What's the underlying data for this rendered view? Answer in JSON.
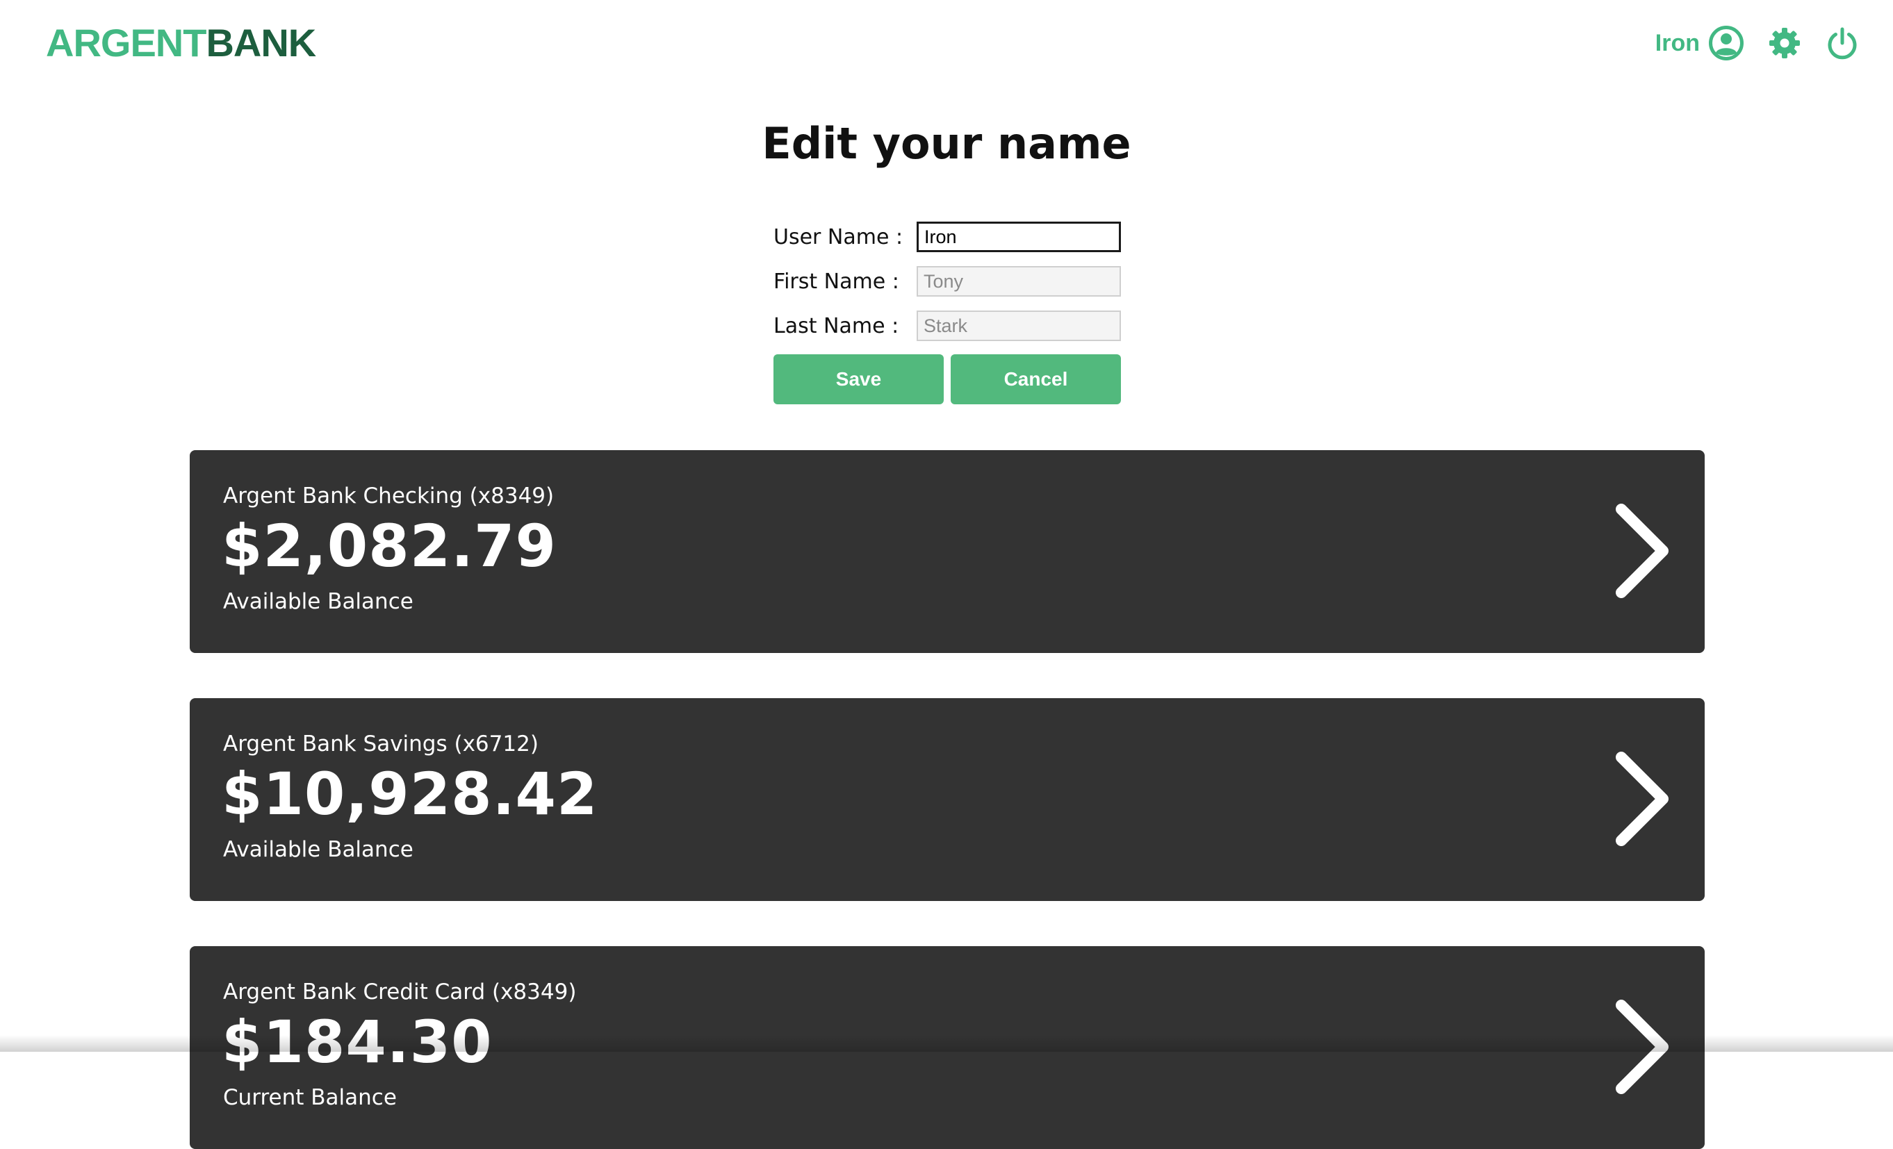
{
  "header": {
    "logo_part1": "ARGENT",
    "logo_part2": "BANK",
    "user_name": "Iron",
    "icons": [
      "user-circle-icon",
      "gear-icon",
      "power-icon"
    ],
    "accent_color": "#42b883"
  },
  "edit_name": {
    "title": "Edit your name",
    "fields": [
      {
        "label": "User Name :",
        "value": "Iron",
        "editable": true
      },
      {
        "label": "First Name :",
        "value": "Tony",
        "editable": false
      },
      {
        "label": "Last Name :",
        "value": "Stark",
        "editable": false
      }
    ],
    "save_label": "Save",
    "cancel_label": "Cancel"
  },
  "accounts": [
    {
      "title": "Argent Bank Checking (x8349)",
      "amount": "$2,082.79",
      "description": "Available Balance"
    },
    {
      "title": "Argent Bank Savings (x6712)",
      "amount": "$10,928.42",
      "description": "Available Balance"
    },
    {
      "title": "Argent Bank Credit Card (x8349)",
      "amount": "$184.30",
      "description": "Current Balance"
    }
  ]
}
